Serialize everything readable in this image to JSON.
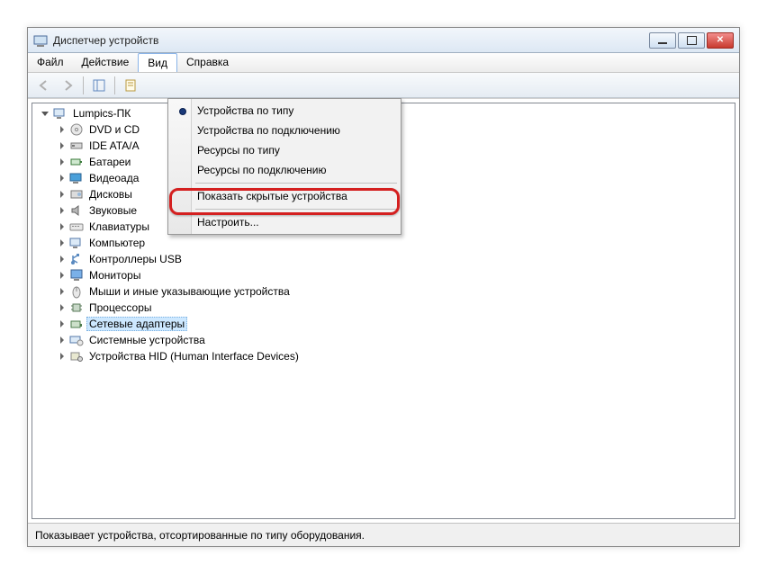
{
  "window": {
    "title": "Диспетчер устройств"
  },
  "menu": {
    "file": "Файл",
    "action": "Действие",
    "view": "Вид",
    "help": "Справка"
  },
  "view_menu": {
    "by_type": "Устройства по типу",
    "by_connection": "Устройства по подключению",
    "res_by_type": "Ресурсы по типу",
    "res_by_connection": "Ресурсы по подключению",
    "show_hidden": "Показать скрытые устройства",
    "customize": "Настроить..."
  },
  "tree": {
    "root": "Lumpics-ПК",
    "items": [
      "DVD и CD",
      "IDE ATA/A",
      "Батареи",
      "Видеоада",
      "Дисковы",
      "Звуковые",
      "Клавиатуры",
      "Компьютер",
      "Контроллеры USB",
      "Мониторы",
      "Мыши и иные указывающие устройства",
      "Процессоры",
      "Сетевые адаптеры",
      "Системные устройства",
      "Устройства HID (Human Interface Devices)"
    ],
    "selected_index": 12
  },
  "status": {
    "text": "Показывает устройства, отсортированные по типу оборудования."
  },
  "icons": {
    "app": "computer-management-icon",
    "dvd": "disc-icon",
    "ide": "ide-icon",
    "battery": "battery-icon",
    "video": "display-adapter-icon",
    "disk": "disk-icon",
    "sound": "sound-icon",
    "keyboard": "keyboard-icon",
    "computer": "computer-icon",
    "usb": "usb-icon",
    "monitor": "monitor-icon",
    "mouse": "mouse-icon",
    "cpu": "cpu-icon",
    "network": "network-adapter-icon",
    "system": "system-device-icon",
    "hid": "hid-icon"
  }
}
